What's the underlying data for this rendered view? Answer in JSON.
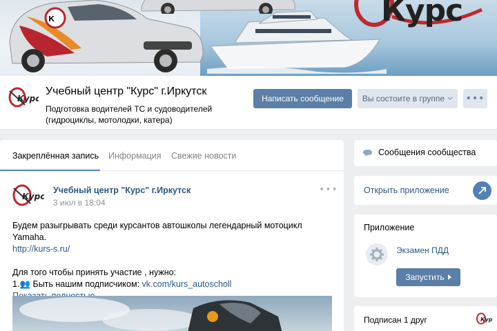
{
  "cover": {
    "logo_text": "Курс"
  },
  "group": {
    "logo_text": "Курс",
    "title": "Учебный центр \"Курс\" г.Иркутск",
    "status_line1": "Подготовка водителей ТС и судоводителей",
    "status_line2": "(гидроциклы, мотолодки, катера)",
    "message_button": "Написать сообщение",
    "member_button": "Вы состоите в группе",
    "more_button": "•••"
  },
  "tabs": [
    {
      "label": "Закреплённая запись"
    },
    {
      "label": "Информация"
    },
    {
      "label": "Свежие новости"
    }
  ],
  "post": {
    "author": "Учебный центр \"Курс\" г.Иркутск",
    "date": "3 июл в 18:04",
    "more": "•••",
    "line1": "Будем разыгрывать среди курсантов автошколы легендарный мотоцикл Yamaha.",
    "link1": "http://kurs-s.ru/",
    "line2": "Для того чтобы принять участие , нужно:",
    "item1_prefix": "1.",
    "item1_emoji": "👥",
    "item1_text": " Быть нашим подписчиком: ",
    "item1_link": "vk.com/kurs_autoscholl",
    "show_more": "Показать полностью..."
  },
  "sidebar": {
    "messages": "Сообщения сообщества",
    "open_app": "Открыть приложение",
    "app_title": "Приложение",
    "app_name": "Экзамен ПДД",
    "app_button": "Запустить",
    "friends": "Подписан 1 друг"
  },
  "colors": {
    "accent": "#5181b8",
    "button": "#5b7fa6",
    "link": "#2a5885",
    "page_bg": "#edeef0"
  }
}
